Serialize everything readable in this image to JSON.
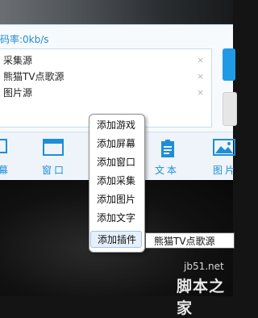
{
  "stats": {
    "rate_label": "码率:0kb/s"
  },
  "sources": [
    {
      "name": "采集源",
      "close": "×"
    },
    {
      "name": "熊猫TV点歌源",
      "close": "×"
    },
    {
      "name": "图片源",
      "close": "×"
    }
  ],
  "toolbar": [
    {
      "label": "幕",
      "icon": "screen-icon"
    },
    {
      "label": "窗口",
      "icon": "window-icon"
    },
    {
      "label": "文本",
      "icon": "text-doc-icon"
    },
    {
      "label": "图片",
      "icon": "picture-icon"
    }
  ],
  "context_menu": {
    "items": [
      "添加游戏",
      "添加屏幕",
      "添加窗口",
      "添加采集",
      "添加图片",
      "添加文字",
      "添加插件"
    ],
    "highlighted_index": 6
  },
  "preview": {
    "source_label": "熊猫TV点歌源"
  },
  "watermark": {
    "site": "jb51.net",
    "name": "脚本之家"
  },
  "colors": {
    "accent": "#1e8ed8",
    "panel": "#f7fafc",
    "menu_highlight": "#e6f0fb"
  }
}
